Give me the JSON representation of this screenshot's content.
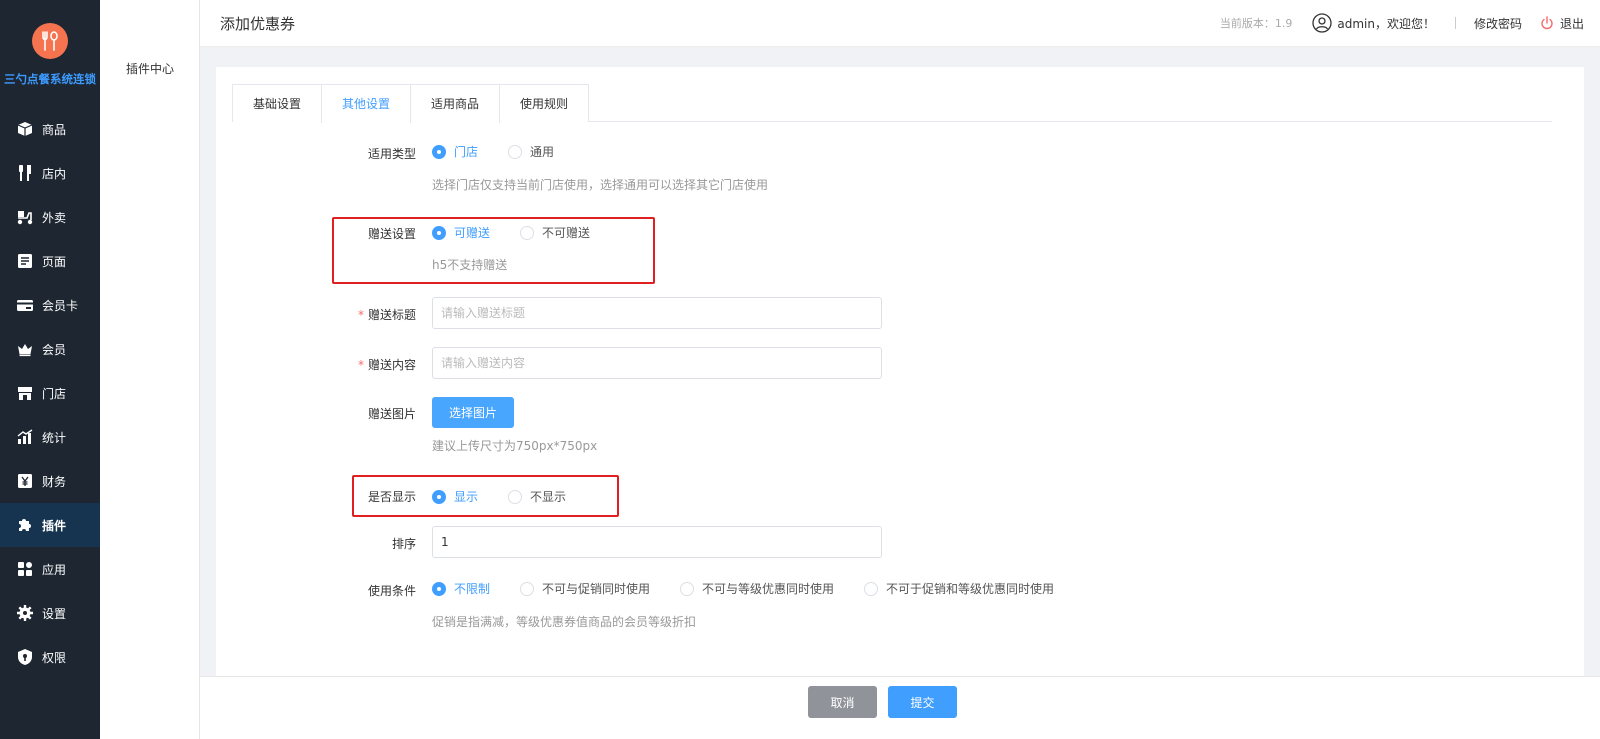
{
  "sidebar": {
    "brand": "三勺点餐系统连锁",
    "items": [
      {
        "label": "商品",
        "icon": "box-icon"
      },
      {
        "label": "店内",
        "icon": "utensils-icon"
      },
      {
        "label": "外卖",
        "icon": "scooter-icon"
      },
      {
        "label": "页面",
        "icon": "document-icon"
      },
      {
        "label": "会员卡",
        "icon": "card-icon"
      },
      {
        "label": "会员",
        "icon": "crown-icon"
      },
      {
        "label": "门店",
        "icon": "store-icon"
      },
      {
        "label": "统计",
        "icon": "chart-icon"
      },
      {
        "label": "财务",
        "icon": "yen-icon"
      },
      {
        "label": "插件",
        "icon": "puzzle-icon"
      },
      {
        "label": "应用",
        "icon": "apps-icon"
      },
      {
        "label": "设置",
        "icon": "gear-icon"
      },
      {
        "label": "权限",
        "icon": "shield-icon"
      }
    ],
    "active": "插件"
  },
  "subnav": {
    "item": "插件中心"
  },
  "header": {
    "title": "添加优惠券",
    "version": "当前版本：1.9",
    "user": "admin，欢迎您！",
    "change_password": "修改密码",
    "logout": "退出"
  },
  "tabs": [
    "基础设置",
    "其他设置",
    "适用商品",
    "使用规则"
  ],
  "active_tab": "其他设置",
  "form": {
    "apply_type": {
      "label": "适用类型",
      "options": [
        "门店",
        "通用"
      ],
      "selected": "门店",
      "help": "选择门店仅支持当前门店使用，选择通用可以选择其它门店使用"
    },
    "gift": {
      "label": "赠送设置",
      "options": [
        "可赠送",
        "不可赠送"
      ],
      "selected": "可赠送",
      "help": "h5不支持赠送"
    },
    "gift_title": {
      "required_mark": "*",
      "label": "赠送标题",
      "placeholder": "请输入赠送标题",
      "value": ""
    },
    "gift_content": {
      "required_mark": "*",
      "label": "赠送内容",
      "placeholder": "请输入赠送内容",
      "value": ""
    },
    "gift_image": {
      "label": "赠送图片",
      "button": "选择图片",
      "help": "建议上传尺寸为750px*750px"
    },
    "display": {
      "label": "是否显示",
      "options": [
        "显示",
        "不显示"
      ],
      "selected": "显示"
    },
    "sort": {
      "label": "排序",
      "value": "1"
    },
    "conditions": {
      "label": "使用条件",
      "options": [
        "不限制",
        "不可与促销同时使用",
        "不可与等级优惠同时使用",
        "不可于促销和等级优惠同时使用"
      ],
      "selected": "不限制",
      "help": "促销是指满减，等级优惠券值商品的会员等级折扣"
    }
  },
  "footer": {
    "cancel": "取消",
    "submit": "提交"
  },
  "colors": {
    "primary": "#409eff",
    "sidebar": "#1d2631",
    "highlight": "#e02020",
    "logo": "#f5734f"
  }
}
